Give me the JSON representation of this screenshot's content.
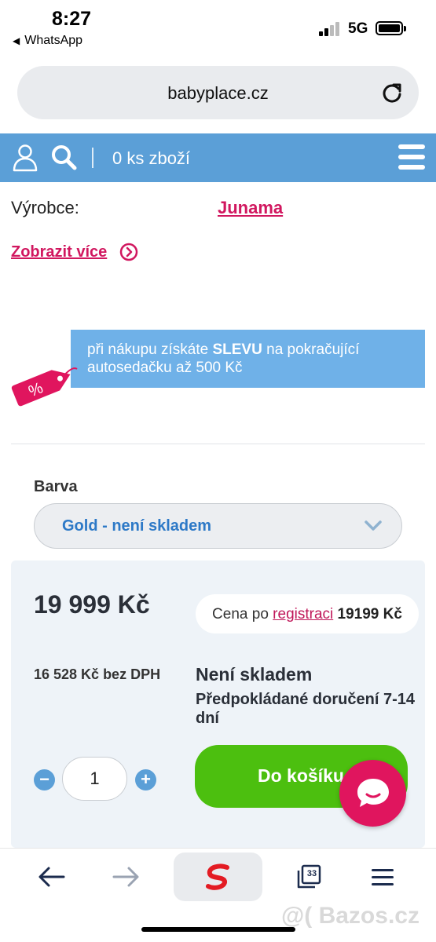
{
  "status_bar": {
    "time": "8:27",
    "back_app": "WhatsApp",
    "network": "5G"
  },
  "browser": {
    "url": "babyplace.cz"
  },
  "header": {
    "cart_count": "0 ks zboží"
  },
  "product": {
    "manufacturer_label": "Výrobce:",
    "manufacturer": "Junama",
    "show_more": "Zobrazit více"
  },
  "discount": {
    "prefix": "při nákupu získáte ",
    "highlight": "SLEVU",
    "suffix": " na pokračující autosedačku až 500 Kč",
    "tag_symbol": "%"
  },
  "variant": {
    "label": "Barva",
    "selected": "Gold - není skladem"
  },
  "pricing": {
    "price": "19 999 Kč",
    "registration_prefix": "Cena po ",
    "registration_link": "registraci",
    "registration_price": "19199 Kč",
    "price_without_vat": "16 528 Kč bez DPH",
    "stock_status": "Není skladem",
    "delivery": "Předpokládané doručení 7-14 dní"
  },
  "cart": {
    "quantity": "1",
    "minus": "−",
    "plus": "+",
    "add_label": "Do košíku"
  },
  "toolbar": {
    "tabs_count": "33"
  },
  "watermark": "@( Bazos.cz",
  "colors": {
    "header_blue": "#5b9fd7",
    "brand_pink": "#d1175f",
    "banner_blue": "#6fb1e8",
    "cta_green": "#4cbf0f",
    "select_text_blue": "#2d79c7"
  },
  "icons": [
    "reload-icon",
    "user-icon",
    "search-icon",
    "menu-icon",
    "chevron-right-circle-icon",
    "discount-tag-icon",
    "chevron-down-icon",
    "chat-icon",
    "back-arrow-icon",
    "forward-arrow-icon",
    "site-logo-icon",
    "tabs-icon",
    "menu-lines-icon"
  ]
}
